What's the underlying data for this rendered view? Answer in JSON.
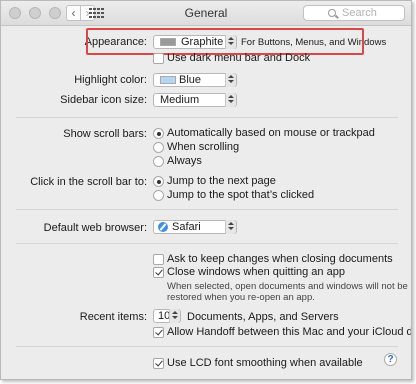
{
  "window": {
    "title": "General"
  },
  "toolbar": {
    "back_label": "‹",
    "forward_label": "›",
    "search_placeholder": "Search"
  },
  "appearance": {
    "label": "Appearance:",
    "value": "Graphite",
    "hint": "For Buttons, Menus, and Windows",
    "swatch_color": "#9a9a9a"
  },
  "dark_menu": {
    "label": "Use dark menu bar and Dock",
    "checked": false
  },
  "highlight": {
    "label": "Highlight color:",
    "value": "Blue",
    "swatch_color": "#b7d4f5"
  },
  "sidebar_icon": {
    "label": "Sidebar icon size:",
    "value": "Medium"
  },
  "scroll_bars": {
    "label": "Show scroll bars:",
    "options": [
      "Automatically based on mouse or trackpad",
      "When scrolling",
      "Always"
    ],
    "selected": 0
  },
  "click_scroll": {
    "label": "Click in the scroll bar to:",
    "options": [
      "Jump to the next page",
      "Jump to the spot that’s clicked"
    ],
    "selected": 0
  },
  "browser": {
    "label": "Default web browser:",
    "value": "Safari"
  },
  "documents": {
    "ask_keep": {
      "label": "Ask to keep changes when closing documents",
      "checked": false
    },
    "close_windows": {
      "label": "Close windows when quitting an app",
      "checked": true
    },
    "note_line1": "When selected, open documents and windows will not be",
    "note_line2": "restored when you re-open an app."
  },
  "recent": {
    "label": "Recent items:",
    "value": "10",
    "suffix": "Documents, Apps, and Servers"
  },
  "handoff": {
    "label": "Allow Handoff between this Mac and your iCloud devices",
    "checked": true
  },
  "lcd": {
    "label": "Use LCD font smoothing when available",
    "checked": true
  },
  "help_label": "?"
}
